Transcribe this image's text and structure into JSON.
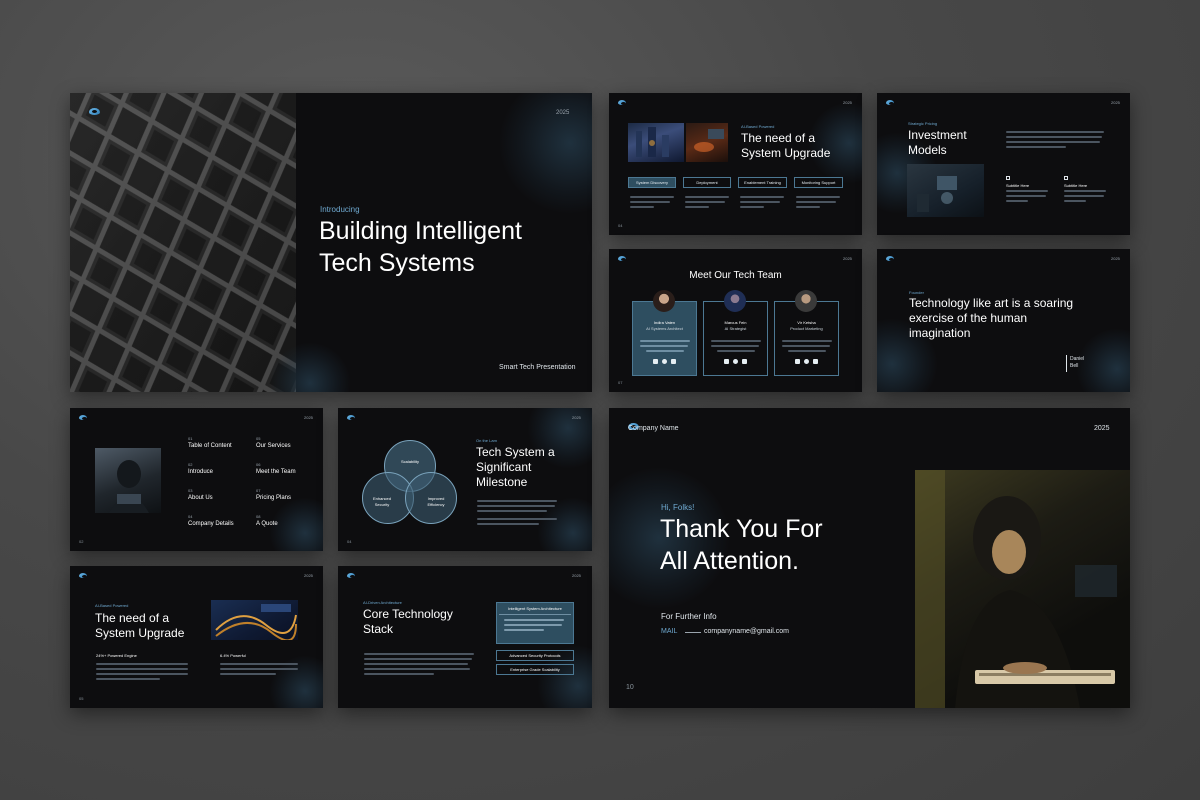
{
  "colors": {
    "accent": "#6fa9d0",
    "panel": "#2e4e60",
    "background": "#0d0d0f"
  },
  "slide1": {
    "year": "2025",
    "eyebrow": "Introducing",
    "title_line1": "Building Intelligent",
    "title_line2": "Tech Systems",
    "footer": "Smart Tech Presentation"
  },
  "slide2": {
    "year": "2025",
    "eyebrow": "AI-Based Powered",
    "title_line1": "The need of a",
    "title_line2": "System Upgrade",
    "tabs": [
      "System Discovery",
      "Deployment",
      "Enablement Training",
      "Monitoring Support"
    ],
    "page": "04"
  },
  "slide3": {
    "year": "2025",
    "eyebrow": "Strategic Pricing",
    "title_line1": "Investment",
    "title_line2": "Models",
    "subtitles": [
      "Subtitle Here",
      "Subtitle Here"
    ]
  },
  "slide4": {
    "year": "2025",
    "title": "Meet Our Tech Team",
    "members": [
      {
        "name": "Indira Vaten",
        "role": "AI Systems Architect"
      },
      {
        "name": "Marcus Fein",
        "role": "AI Strategist"
      },
      {
        "name": "Vir Ketsha",
        "role": "Product Marketing"
      }
    ],
    "page": "07"
  },
  "slide5": {
    "year": "2025",
    "eyebrow": "Founder",
    "quote_line1": "Technology like art is a soaring",
    "quote_line2": "exercise of the human",
    "quote_line3": "imagination",
    "author_line1": "Daniel",
    "author_line2": "Bell"
  },
  "slide6": {
    "year": "2025",
    "items": [
      {
        "num": "01",
        "label": "Table of Content"
      },
      {
        "num": "02",
        "label": "Introduce"
      },
      {
        "num": "03",
        "label": "About Us"
      },
      {
        "num": "04",
        "label": "Company Details"
      },
      {
        "num": "05",
        "label": "Our Services"
      },
      {
        "num": "06",
        "label": "Meet the Team"
      },
      {
        "num": "07",
        "label": "Pricing Plans"
      },
      {
        "num": "08",
        "label": "A Quote"
      }
    ],
    "page": "02"
  },
  "slide7": {
    "year": "2025",
    "eyebrow": "On the Lam",
    "title_line1": "Tech System a",
    "title_line2": "Significant",
    "title_line3": "Milestone",
    "venn": [
      "Scalability",
      "Enhanced",
      "Security",
      "Improved",
      "Efficiency"
    ],
    "page": "04"
  },
  "slide8": {
    "year": "2025",
    "eyebrow": "AI-Based Powered",
    "title_line1": "The need of a",
    "title_line2": "System Upgrade",
    "stat1": "24%+ Powered Engine",
    "stat2": "6.4% Powerful",
    "page": "05"
  },
  "slide9": {
    "year": "2025",
    "eyebrow": "AI-Driven Architecture",
    "title_line1": "Core Technology",
    "title_line2": "Stack",
    "boxes": [
      "Intelligent System Architecture",
      "Advanced Security Protocols",
      "Enterprise Grade Scalability"
    ]
  },
  "slide10": {
    "company": "Company Name",
    "year": "2025",
    "greeting": "Hi, Folks!",
    "title_line1": "Thank You For",
    "title_line2": "All Attention.",
    "info_label": "For Further Info",
    "mail_label": "MAIL",
    "email": "companyname@gmail.com",
    "page": "10"
  }
}
